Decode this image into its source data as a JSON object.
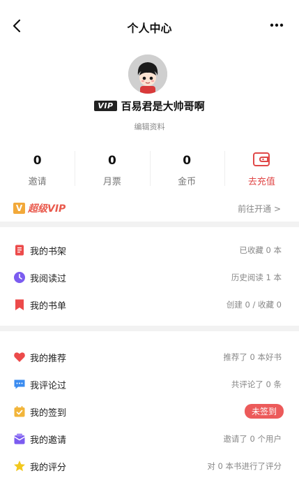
{
  "header": {
    "title": "个人中心",
    "back_icon": "chevron-left-icon",
    "more_icon": "more-dots-icon"
  },
  "profile": {
    "vip_badge": "VIP",
    "username": "百易君是大帅哥啊",
    "edit_label": "编辑资料",
    "avatar_icon": "avatar-cartoon"
  },
  "stats": [
    {
      "value": "0",
      "label": "邀请"
    },
    {
      "value": "0",
      "label": "月票"
    },
    {
      "value": "0",
      "label": "金币"
    }
  ],
  "recharge": {
    "label": "去充值",
    "icon": "wallet-icon"
  },
  "vip": {
    "badge": "V",
    "title": "超级VIP",
    "action": "前往开通 >"
  },
  "group1": [
    {
      "label": "我的书架",
      "value": "已收藏 0 本",
      "icon": "bookshelf-icon",
      "color": "#ec4a4a"
    },
    {
      "label": "我阅读过",
      "value": "历史阅读 1 本",
      "icon": "clock-icon",
      "color": "#7b5cf0"
    },
    {
      "label": "我的书单",
      "value": "创建 0 / 收藏 0",
      "icon": "bookmark-icon",
      "color": "#ec4a4a"
    }
  ],
  "group2": [
    {
      "label": "我的推荐",
      "value": "推荐了 0 本好书",
      "icon": "heart-icon",
      "color": "#ec4a4a"
    },
    {
      "label": "我评论过",
      "value": "共评论了 0 条",
      "icon": "comment-icon",
      "color": "#3b8cf0"
    },
    {
      "label": "我的签到",
      "value": "未签到",
      "icon": "checkin-icon",
      "color": "#f2b53a"
    },
    {
      "label": "我的邀请",
      "value": "邀请了 0 个用户",
      "icon": "invite-icon",
      "color": "#7b5cf0"
    },
    {
      "label": "我的评分",
      "value": "对 0 本书进行了评分",
      "icon": "star-icon",
      "color": "#f2c81e"
    }
  ]
}
